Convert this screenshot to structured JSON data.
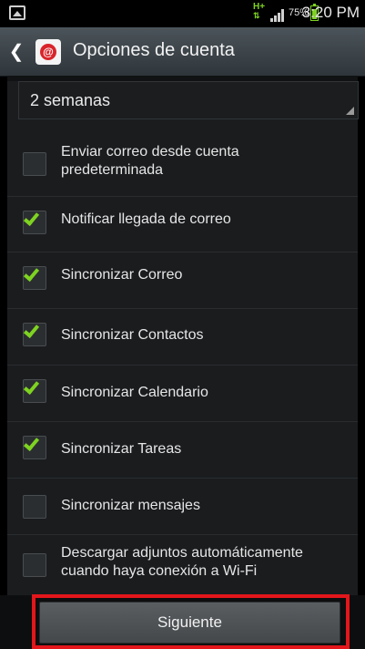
{
  "status_bar": {
    "network": "H+",
    "battery_percent": "75%",
    "battery_level": 0.75,
    "time": "3:20 PM"
  },
  "title_bar": {
    "title": "Opciones de cuenta"
  },
  "sync_interval": {
    "value": "2 semanas"
  },
  "options": [
    {
      "label_lines": [
        "Enviar correo desde cuenta",
        "predeterminada"
      ],
      "checked": false
    },
    {
      "label_lines": [
        "Notificar llegada de correo"
      ],
      "checked": true
    },
    {
      "label_lines": [
        "Sincronizar Correo"
      ],
      "checked": true
    },
    {
      "label_lines": [
        "Sincronizar Contactos"
      ],
      "checked": true
    },
    {
      "label_lines": [
        "Sincronizar Calendario"
      ],
      "checked": true
    },
    {
      "label_lines": [
        "Sincronizar Tareas"
      ],
      "checked": true
    },
    {
      "label_lines": [
        "Sincronizar mensajes"
      ],
      "checked": false
    },
    {
      "label_lines": [
        "Descargar adjuntos automáticamente",
        "cuando haya conexión a Wi-Fi"
      ],
      "checked": false
    }
  ],
  "next_button": {
    "label": "Siguiente"
  },
  "colors": {
    "check_green": "#7ed321",
    "highlight_red": "#e3161b"
  }
}
